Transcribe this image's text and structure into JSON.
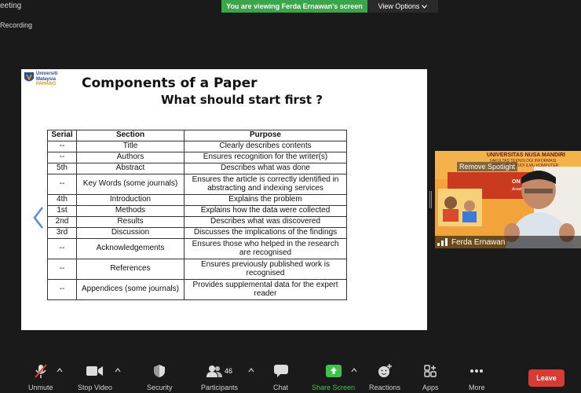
{
  "window": {
    "title": "eeting",
    "recording": "Recording"
  },
  "banner": {
    "viewing": "You are viewing Ferda Ernawan's screen",
    "options": "View Options"
  },
  "slide": {
    "logo_lines": [
      "Universiti",
      "Malaysia",
      "PAHANG"
    ],
    "title": "Components of a Paper",
    "subtitle": "What should start first ?",
    "table": {
      "headers": [
        "Serial",
        "Section",
        "Purpose"
      ],
      "rows": [
        {
          "serial": "--",
          "section": "Title",
          "purpose": "Clearly describes contents"
        },
        {
          "serial": "--",
          "section": "Authors",
          "purpose": "Ensures recognition for the writer(s)"
        },
        {
          "serial": "5th",
          "section": "Abstract",
          "purpose": "Describes what was done"
        },
        {
          "serial": "--",
          "section": "Key Words (some journals)",
          "purpose": "Ensures the article is correctly identified in abstracting and indexing services"
        },
        {
          "serial": "4th",
          "section": "Introduction",
          "purpose": "Explains the problem"
        },
        {
          "serial": "1st",
          "section": "Methods",
          "purpose": "Explains how the data were collected"
        },
        {
          "serial": "2nd",
          "section": "Results",
          "purpose": "Describes what was discovered"
        },
        {
          "serial": "3rd",
          "section": "Discussion",
          "purpose": "Discusses the implications of the findings"
        },
        {
          "serial": "--",
          "section": "Acknowledgements",
          "purpose": "Ensures those who helped in the research are recognised"
        },
        {
          "serial": "--",
          "section": "References",
          "purpose": "Ensures previously published work is recognised"
        },
        {
          "serial": "--",
          "section": "Appendices (some journals)",
          "purpose": "Provides supplemental data for the expert reader"
        }
      ]
    }
  },
  "video": {
    "uni": "UNIVERSITAS NUSA MANDIRI",
    "line1": "FAKULTAS TEKNOLOGI INFORMASI",
    "line2": "PROGRAM STUDI ILMU KOMPUTER",
    "red_title": "ON INTE... PUBLICATION",
    "red_sub": "Academic Writing ... Proceeding",
    "ar": "AR",
    "remove_spotlight": "Remove Spotlight",
    "name": "Ferda Ernawan"
  },
  "toolbar": {
    "unmute": "Unmute",
    "stop_video": "Stop Video",
    "security": "Security",
    "participants": "Participants",
    "participants_count": "46",
    "chat": "Chat",
    "share_screen": "Share Screen",
    "reactions": "Reactions",
    "apps": "Apps",
    "more": "More",
    "leave": "Leave"
  },
  "colors": {
    "banner_green": "#3aa64a",
    "leave_red": "#d83a34",
    "share_green": "#3ec24a"
  }
}
